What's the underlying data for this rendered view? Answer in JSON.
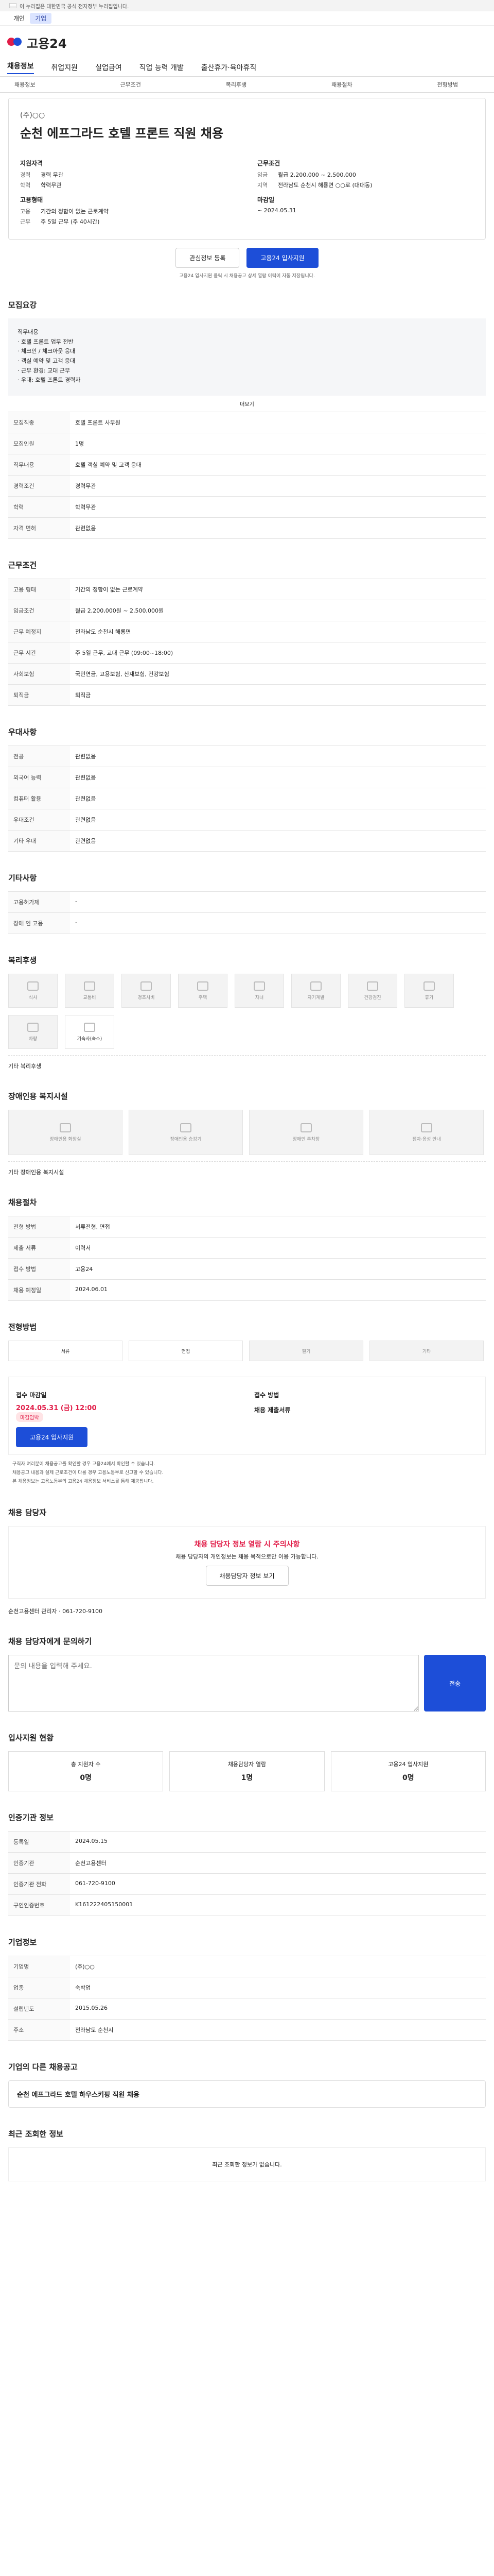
{
  "gov": "이 누리집은 대한민국 공식 전자정부 누리집입니다.",
  "top": {
    "left": "개인",
    "right": "기업"
  },
  "logo": "고용24",
  "gnb": [
    "채용정보",
    "취업지원",
    "실업급여",
    "직업 능력 개발",
    "출산휴가·육아휴직"
  ],
  "lnb": [
    "채용정보",
    "근무조건",
    "복리후생",
    "채용절차",
    "전형방법"
  ],
  "job": {
    "corp": "(주)○○",
    "title": "순천 에프그라드 호텔 프론트 직원 채용"
  },
  "left": {
    "l1": "지원자격",
    "rows1": [
      [
        "경력",
        "경력 무관"
      ],
      [
        "학력",
        "학력무관"
      ]
    ],
    "l2": "고용형태",
    "rows2": [
      [
        "고용",
        "기간의 정함이 없는 근로계약"
      ],
      [
        "근무",
        "주 5일 근무 (주 40시간)"
      ]
    ]
  },
  "right": {
    "l1": "근무조건",
    "rows1": [
      [
        "임금",
        "월급 2,200,000 ~ 2,500,000"
      ],
      [
        "지역",
        "전라남도 순천시 해룡면 ○○로 (대대동)"
      ]
    ],
    "l2": "마감일",
    "deadline": "~ 2024.05.31"
  },
  "buttons": {
    "scrap": "관심정보 등록",
    "apply": "고용24 입사지원"
  },
  "note": "고용24 입사지원 클릭 시 채용공고 상세 열람 이력이 자동 저장됩니다.",
  "s1": {
    "h": "모집요강",
    "body": "직무내용\n· 호텔 프론트 업무 전반\n· 체크인 / 체크아웃 응대\n· 객실 예약 및 고객 응대\n· 근무 환경: 교대 근무\n· 우대: 호텔 프론트 경력자",
    "more": "더보기"
  },
  "kv1": [
    [
      "모집직종",
      "호텔 프론트 사무원"
    ],
    [
      "모집인원",
      "1명"
    ],
    [
      "직무내용",
      "호텔 객실 예약 및 고객 응대"
    ],
    [
      "경력조건",
      "경력무관"
    ],
    [
      "학력",
      "학력무관"
    ],
    [
      "자격 면허",
      "관련없음"
    ]
  ],
  "s2": {
    "h": "근무조건"
  },
  "kv2": [
    [
      "고용 형태",
      "기간의 정함이 없는 근로계약"
    ],
    [
      "임금조건",
      "월급 2,200,000원 ~ 2,500,000원"
    ],
    [
      "근무 예정지",
      "전라남도 순천시 해룡면"
    ],
    [
      "근무 시간",
      "주 5일 근무, 교대 근무 (09:00~18:00)"
    ],
    [
      "사회보험",
      "국민연금, 고용보험, 산재보험, 건강보험"
    ],
    [
      "퇴직금",
      "퇴직금"
    ]
  ],
  "s3": {
    "h": "우대사항"
  },
  "kv3": [
    [
      "전공",
      "관련없음"
    ],
    [
      "외국어 능력",
      "관련없음"
    ],
    [
      "컴퓨터 활용",
      "관련없음"
    ],
    [
      "우대조건",
      "관련없음"
    ],
    [
      "기타 우대",
      "관련없음"
    ]
  ],
  "s4": {
    "h": "기타사항",
    "rows": [
      [
        "고용허가제",
        "-"
      ],
      [
        "장애 인 고용",
        "-"
      ]
    ]
  },
  "s5": {
    "h": "복리후생",
    "tiles": [
      "식사",
      "교통비",
      "경조사비",
      "주택",
      "자녀",
      "자기계발",
      "건강검진",
      "휴가",
      "차량",
      "기숙사(숙소)"
    ],
    "extra": "기타 복리후생"
  },
  "s6": {
    "h": "장애인용 복지시설",
    "tiles": [
      "장애인용 화장실",
      "장애인용 승강기",
      "장애인 주차장",
      "점자·음성 안내"
    ],
    "extra": "기타 장애인용 복지시설"
  },
  "s7": {
    "h": "채용절차"
  },
  "kv7": [
    [
      "전형 방법",
      "서류전형, 면접"
    ],
    [
      "제출 서류",
      "이력서"
    ],
    [
      "접수 방법",
      "고용24"
    ],
    [
      "채용 예정일",
      "2024.06.01"
    ]
  ],
  "s8": {
    "h": "전형방법",
    "tabs": [
      "서류",
      "면접",
      "필기",
      "기타"
    ]
  },
  "s9": {
    "dl": "접수 마감일",
    "date": "2024.05.31 (금) 12:00",
    "tag": "마감임박",
    "left": "접수 방법",
    "right": "채용 제출서류",
    "apply": "고용24 입사지원"
  },
  "bullets": [
    "구직자 여러분이 채용공고를 확인할 경우 고용24에서 확인할 수 있습니다.",
    "채용공고 내용과 실제 근로조건이 다를 경우 고용노동부로 신고할 수 있습니다.",
    "본 채용정보는 고용노동부의 고용24 채용정보 서비스를 통해 제공됩니다."
  ],
  "warn": {
    "t": "채용 담당자 정보 열람 시 주의사항",
    "b": "채용 담당자의 개인정보는 채용 목적으로만 이용 가능합니다.",
    "btn": "채용담당자 정보 보기"
  },
  "contact": {
    "h": "채용 담당자",
    "name": "순천고용센터 관리자",
    "phone": "061-720-9100"
  },
  "inquiry": {
    "h": "채용 담당자에게 문의하기",
    "placeholder": "문의 내용을 입력해 주세요.",
    "btn": "전송"
  },
  "stats": {
    "h": "입사지원 현황",
    "items": [
      [
        "총 지원자 수",
        "0명"
      ],
      [
        "채용담당자 열람",
        "1명"
      ],
      [
        "고용24 입사지원",
        "0명"
      ]
    ]
  },
  "agency": {
    "h": "인증기관 정보",
    "rows": [
      [
        "등록일",
        "2024.05.15"
      ],
      [
        "인증기관",
        "순천고용센터"
      ],
      [
        "인증기관 전화",
        "061-720-9100"
      ],
      [
        "구인인증번호",
        "K161222405150001"
      ]
    ]
  },
  "company": {
    "h": "기업정보",
    "rows": [
      [
        "기업명",
        "(주)○○"
      ],
      [
        "업종",
        "숙박업"
      ],
      [
        "설립년도",
        "2015.05.26"
      ],
      [
        "주소",
        "전라남도 순천시"
      ]
    ]
  },
  "other": {
    "h": "기업의 다른 채용공고",
    "title": "순천 에프그라드 호텔 하우스키핑 직원 채용"
  },
  "recent": {
    "h": "최근 조회한 정보",
    "empty": "최근 조회한 정보가 없습니다."
  }
}
